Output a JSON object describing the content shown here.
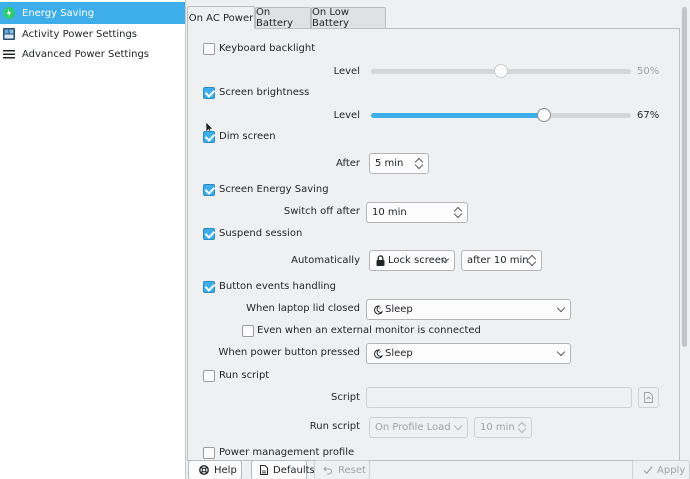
{
  "sidebar": {
    "items": [
      {
        "label": "Energy Saving",
        "icon": "battery-leaf-icon",
        "selected": true
      },
      {
        "label": "Activity Power Settings",
        "icon": "activities-icon",
        "selected": false
      },
      {
        "label": "Advanced Power Settings",
        "icon": "hamburger-menu-icon",
        "selected": false
      }
    ]
  },
  "tabs": [
    {
      "label": "On AC Power",
      "active": true
    },
    {
      "label": "On Battery",
      "active": false
    },
    {
      "label": "On Low Battery",
      "active": false
    }
  ],
  "settings": {
    "keyboard_backlight": {
      "label": "Keyboard backlight",
      "checked": false,
      "level_label": "Level",
      "level_value": "50%",
      "level": 0.5
    },
    "screen_brightness": {
      "label": "Screen brightness",
      "checked": true,
      "level_label": "Level",
      "level_value": "67%",
      "level": 0.67
    },
    "dim_screen": {
      "label": "Dim screen",
      "checked": true,
      "after_label": "After",
      "after_value": "5 min"
    },
    "screen_energy_saving": {
      "label": "Screen Energy Saving",
      "checked": true,
      "switch_off_label": "Switch off after",
      "switch_off_value": "10 min"
    },
    "suspend_session": {
      "label": "Suspend session",
      "checked": true,
      "auto_label": "Automatically",
      "action_value": "Lock screen",
      "after_value": "after 10 min"
    },
    "button_events": {
      "label": "Button events handling",
      "checked": true,
      "lid_label": "When laptop lid closed",
      "lid_value": "Sleep",
      "external_monitor_label": "Even when an external monitor is connected",
      "external_monitor_checked": false,
      "power_button_label": "When power button pressed",
      "power_button_value": "Sleep"
    },
    "run_script": {
      "label": "Run script",
      "checked": false,
      "script_label": "Script",
      "script_value": "",
      "run_label": "Run script",
      "run_value": "On Profile Load",
      "run_after_value": "10 min"
    },
    "power_profile": {
      "label": "Power management profile",
      "checked": false
    }
  },
  "buttons": {
    "help": "Help",
    "defaults": "Defaults",
    "reset": "Reset",
    "apply": "Apply"
  },
  "colors": {
    "accent": "#3daee9",
    "background": "#eff0f1",
    "text": "#232629"
  }
}
